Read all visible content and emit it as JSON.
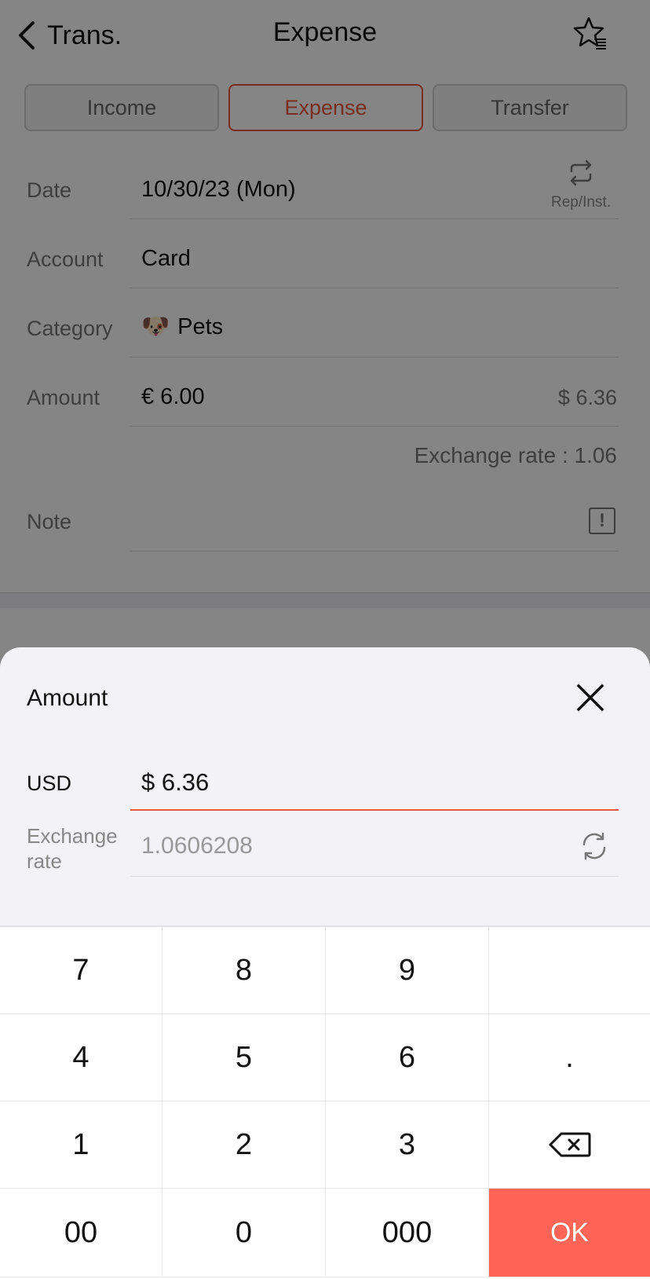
{
  "nav": {
    "back_label": "Trans.",
    "title": "Expense"
  },
  "segments": [
    {
      "label": "Income",
      "active": false
    },
    {
      "label": "Expense",
      "active": true
    },
    {
      "label": "Transfer",
      "active": false
    }
  ],
  "form": {
    "date": {
      "label": "Date",
      "value": "10/30/23 (Mon)",
      "repeat_label": "Rep/Inst."
    },
    "account": {
      "label": "Account",
      "value": "Card"
    },
    "category": {
      "label": "Category",
      "emoji": "🐶",
      "value": "Pets"
    },
    "amount": {
      "label": "Amount",
      "value": "€ 6.00",
      "converted": "$ 6.36"
    },
    "exchange_note": "Exchange rate : 1.06",
    "note": {
      "label": "Note",
      "value": ""
    }
  },
  "sheet": {
    "title": "Amount",
    "currency_label": "USD",
    "currency_value": "$ 6.36",
    "rate_label": "Exchange rate",
    "rate_value": "1.0606208"
  },
  "keypad": {
    "keys": [
      "7",
      "8",
      "9",
      "",
      "4",
      "5",
      "6",
      ".",
      "1",
      "2",
      "3",
      "⌫",
      "00",
      "0",
      "000",
      "OK"
    ]
  },
  "colors": {
    "accent": "#e8573f",
    "ok_button": "#fe6556",
    "sheet_bg": "#f3f2f7"
  },
  "icons": {
    "back": "chevron-left-icon",
    "favorites": "star-list-icon",
    "repeat": "repeat-icon",
    "note": "exclamation-box-icon",
    "close": "close-icon",
    "refresh": "refresh-icon",
    "backspace": "backspace-icon"
  }
}
